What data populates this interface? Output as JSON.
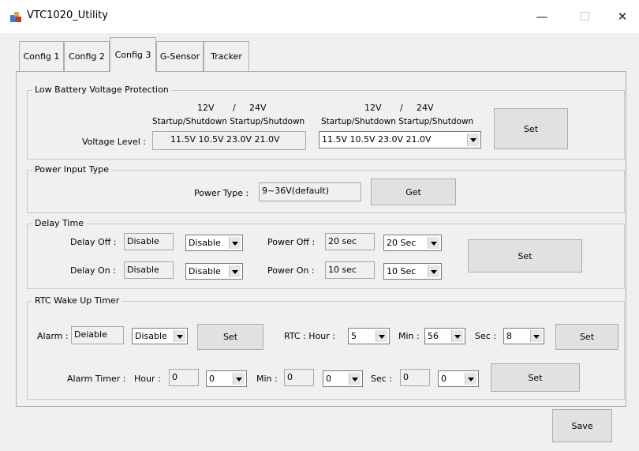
{
  "window": {
    "title": "VTC1020_Utility",
    "minimize": "—",
    "maximize": "☐",
    "close": "✕"
  },
  "tabs": [
    "Config 1",
    "Config 2",
    "Config 3",
    "G-Sensor",
    "Tracker"
  ],
  "low_battery": {
    "legend": "Low Battery Voltage Protection",
    "h12": "12V",
    "slash": "/",
    "h24": "24V",
    "header2": "Startup/Shutdown Startup/Shutdown",
    "voltage_label": "Voltage Level :",
    "current_value": "11.5V  10.5V   23.0V  21.0V",
    "selected_value": "11.5V  10.5V   23.0V  21.0V",
    "set_label": "Set"
  },
  "power_input": {
    "legend": "Power Input Type",
    "type_label": "Power Type :",
    "type_value": "9~36V(default)",
    "get_label": "Get"
  },
  "delay_time": {
    "legend": "Delay Time",
    "off_label": "Delay Off :",
    "off_value": "Disable",
    "off_select": "Disable",
    "on_label": "Delay On :",
    "on_value": "Disable",
    "on_select": "Disable",
    "poff_label": "Power Off :",
    "poff_value": "20 sec",
    "poff_select": "20 Sec",
    "pon_label": "Power On :",
    "pon_value": "10 sec",
    "pon_select": "10 Sec",
    "set_label": "Set"
  },
  "rtc": {
    "legend": "RTC Wake Up Timer",
    "alarm_label": "Alarm :",
    "alarm_value": "Deiable",
    "alarm_select": "Disable",
    "alarm_set": "Set",
    "rtc_label": "RTC :  Hour :",
    "hour_select": "5",
    "min_label": "Min :",
    "min_select": "56",
    "sec_label": "Sec :",
    "sec_select": "8",
    "rtc_set": "Set",
    "timer_label": "Alarm Timer :",
    "t_hour_label": "Hour :",
    "t_hour_value": "0",
    "t_hour_select": "0",
    "t_min_label": "Min :",
    "t_min_value": "0",
    "t_min_select": "0",
    "t_sec_label": "Sec :",
    "t_sec_value": "0",
    "t_sec_select": "0",
    "timer_set": "Set"
  },
  "footer": {
    "save_label": "Save"
  }
}
